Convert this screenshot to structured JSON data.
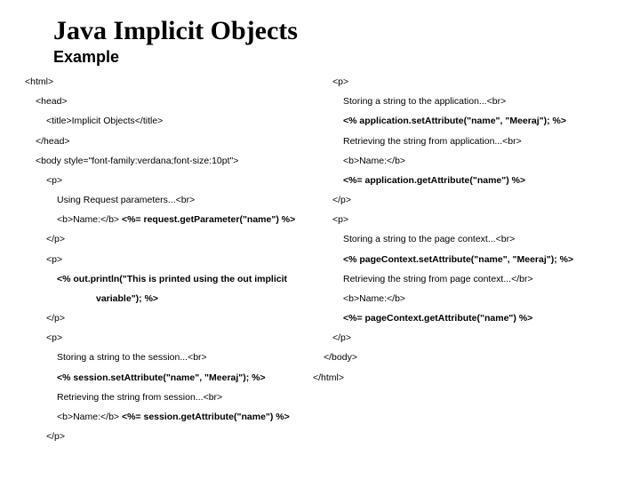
{
  "title": "Java Implicit Objects",
  "subtitle": "Example",
  "left": {
    "l0": "<html>",
    "l1": "<head>",
    "l2": "<title>Implicit Objects</title>",
    "l3": "</head>",
    "l4": "<body style=\"font-family:verdana;font-size:10pt\">",
    "l5": "<p>",
    "l6": "Using Request parameters...<br>",
    "l7a": "<b>Name:</b> ",
    "l7b": "<%= request.getParameter(\"name\") %>",
    "l8": "</p>",
    "l9": "<p>",
    "l10a": "<% out.println(\"This is printed using the out implicit",
    "l10b": "variable\"); %>",
    "l11": "</p>",
    "l12": "<p>",
    "l13": "Storing a string to the session...<br>",
    "l14": "<% session.setAttribute(\"name\", \"Meeraj\"); %>",
    "l15": "Retrieving the string from session...<br>",
    "l16a": "<b>Name:</b> ",
    "l16b": "<%= session.getAttribute(\"name\") %>",
    "l17": "</p>"
  },
  "right": {
    "r0": "<p>",
    "r1": "Storing a string to the application...<br>",
    "r2": "<% application.setAttribute(\"name\", \"Meeraj\"); %>",
    "r3": "Retrieving the string from application...<br>",
    "r4": "<b>Name:</b>",
    "r5": "<%= application.getAttribute(\"name\") %>",
    "r6": "</p>",
    "r7": "<p>",
    "r8": "Storing a string to the page context...<br>",
    "r9": "<% pageContext.setAttribute(\"name\", \"Meeraj\"); %>",
    "r10": "Retrieving the string from page context...</br>",
    "r11": "<b>Name:</b>",
    "r12": "<%= pageContext.getAttribute(\"name\") %>",
    "r13": "</p>",
    "r14": "</body>",
    "r15": "</html>"
  }
}
